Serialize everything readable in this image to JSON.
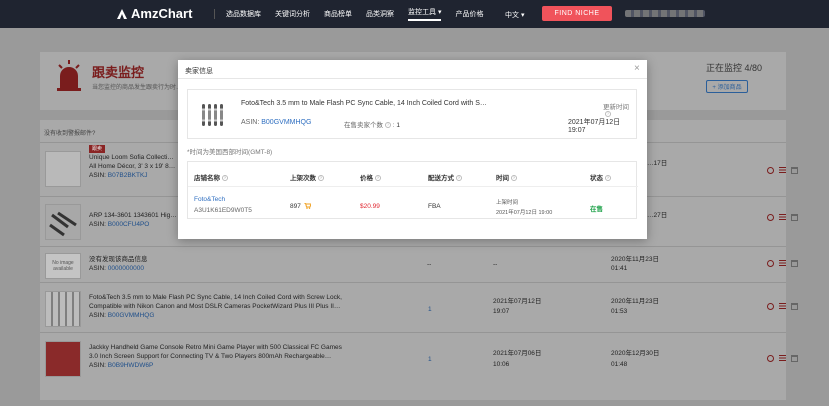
{
  "header": {
    "brand": "AmzChart",
    "nav": [
      "选品数据库",
      "关键词分析",
      "商品榜单",
      "品类洞察",
      "监控工具",
      "产品价格"
    ],
    "active_nav": "监控工具",
    "language": "中文",
    "find_niche": "FIND NICHE"
  },
  "page": {
    "title": "跟卖监控",
    "subtitle": "当您监控的商品发生跟卖行为时…",
    "monitor_count": "正在监控 4/80",
    "add_product": "+ 添加商品",
    "table_hint": "没有收到警报邮件?"
  },
  "rows": [
    {
      "tag": "跟卖",
      "line1": "Unique Loom Sofia Collecti…",
      "line2": "All Home Décor, 3' 3 x 19' 8…",
      "asin_label": "ASIN:",
      "asin": "B07B2BKTKJ",
      "right": "…17日"
    },
    {
      "line1": "ARP 134-3601 1343601 Hig…",
      "asin_label": "ASIN:",
      "asin": "B000CFU4PO",
      "right": "…27日"
    },
    {
      "thumb_text": "No image available",
      "line1": "没有发现该商品信息",
      "asin_label": "ASIN:",
      "asin": "0000000000",
      "seller_count": "--",
      "time": "--",
      "added": "2020年11月23日",
      "added_time": "01:41"
    },
    {
      "line1": "Foto&Tech 3.5 mm to Male Flash PC Sync Cable, 14 Inch Coiled Cord with Screw Lock,",
      "line2": "Compatible with Nikon Canon and Most DSLR Cameras PocketWizard Plus III Plus II…",
      "asin_label": "ASIN:",
      "asin": "B00GVMMHQG",
      "seller_count": "1",
      "time": "2021年07月12日",
      "time2": "19:07",
      "added": "2020年11月23日",
      "added_time": "01:53"
    },
    {
      "line1": "Jackky Handheld Game Console Retro Mini Game Player with 500 Classical FC Games",
      "line2": "3.0 Inch Screen Support for Connecting TV & Two Players 800mAh Rechargeable…",
      "asin_label": "ASIN:",
      "asin": "B0B9HWDW6P",
      "seller_count": "1",
      "time": "2021年07月06日",
      "time2": "10:06",
      "added": "2020年12月30日",
      "added_time": "01:48"
    }
  ],
  "modal": {
    "title": "卖家信息",
    "close": "×",
    "product_name": "Foto&Tech 3.5 mm to Male Flash PC Sync Cable, 14 Inch Coiled Cord with S…",
    "asin_label": "ASIN:",
    "asin": "B00GVMMHQG",
    "sellers_label": "在售卖家个数",
    "sellers_value": "1",
    "update_label": "更新时间",
    "update_value": "2021年07月12日 19:07",
    "tz_note": "*时间为美国西部时间(GMT-8)",
    "columns": [
      "店铺名称",
      "上架次数",
      "价格",
      "配送方式",
      "时间",
      "状态"
    ],
    "seller": {
      "name": "Foto&Tech",
      "id": "A3U1K61ED9W0T5",
      "listings": "897",
      "price": "$20.99",
      "fulfillment": "FBA",
      "time_label": "上架时间",
      "time": "2021年07月12日 19:00",
      "status": "在售"
    },
    "colors": {
      "price": "#e0262f",
      "status": "#1fa24a",
      "link": "#2f6fc1"
    }
  }
}
